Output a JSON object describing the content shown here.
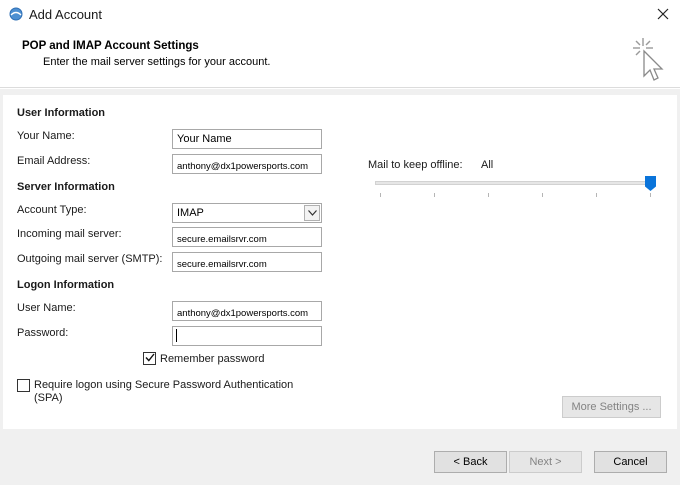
{
  "window": {
    "title": "Add Account",
    "app_icon": "outlook-account-icon",
    "close_icon": "close-icon"
  },
  "header": {
    "title": "POP and IMAP Account Settings",
    "subtitle": "Enter the mail server settings for your account.",
    "icon": "sparkle-cursor-icon"
  },
  "user_info": {
    "section": "User Information",
    "name_label": "Your Name:",
    "name_value": "Your Name",
    "email_label": "Email Address:",
    "email_value": "anthony@dx1powersports.com"
  },
  "server_info": {
    "section": "Server Information",
    "account_type_label": "Account Type:",
    "account_type_value": "IMAP",
    "incoming_label": "Incoming mail server:",
    "incoming_value": "secure.emailsrvr.com",
    "outgoing_label": "Outgoing mail server (SMTP):",
    "outgoing_value": "secure.emailsrvr.com"
  },
  "logon_info": {
    "section": "Logon Information",
    "username_label": "User Name:",
    "username_value": "anthony@dx1powersports.com",
    "password_label": "Password:",
    "password_value": "",
    "remember_label": "Remember password",
    "remember_checked": true,
    "spa_label_line1": "Require logon using Secure Password Authentication",
    "spa_label_line2": "(SPA)",
    "spa_checked": false
  },
  "offline": {
    "label": "Mail to keep offline:",
    "value": "All",
    "slider_level": 1.0
  },
  "buttons": {
    "more_settings": "More Settings ...",
    "back": "< Back",
    "next": "Next >",
    "cancel": "Cancel"
  },
  "colors": {
    "accent": "#0a74da",
    "panel_bg": "#f0f0f0",
    "button_bg": "#e1e1e1"
  }
}
